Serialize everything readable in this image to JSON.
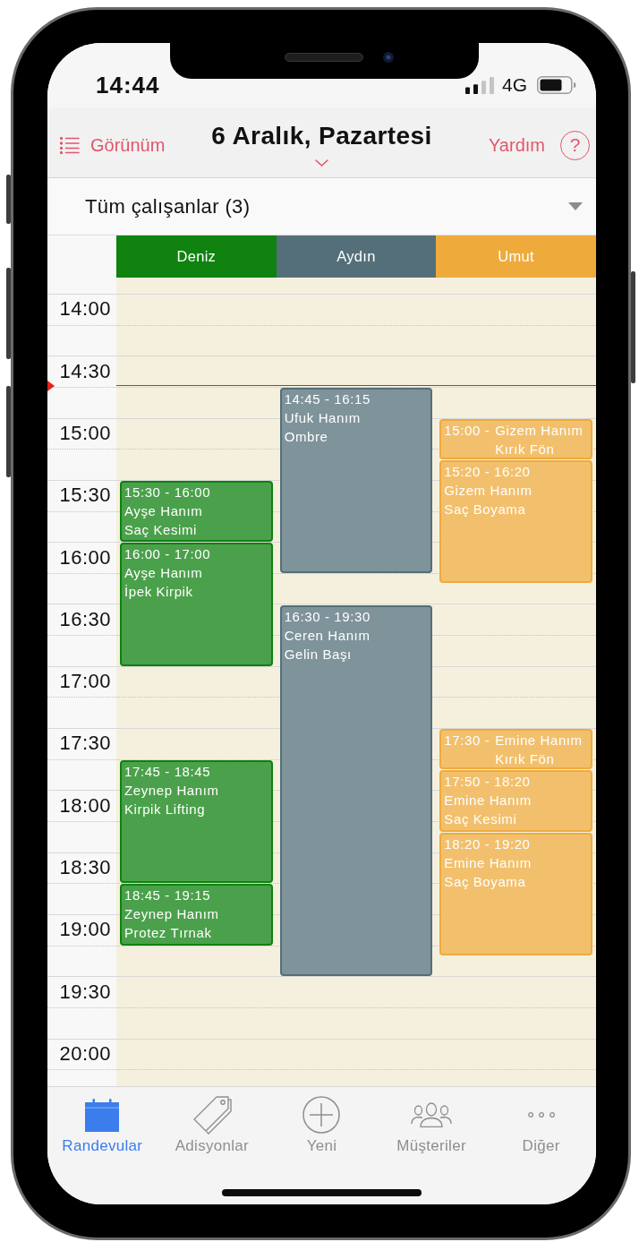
{
  "status_bar": {
    "time": "14:44",
    "network": "4G"
  },
  "header": {
    "view_button": "Görünüm",
    "title": "6 Aralık, Pazartesi",
    "help_link": "Yardım",
    "help_icon": "?"
  },
  "staff_filter": {
    "value": "Tüm çalışanlar (3)"
  },
  "time_slots": [
    "14:00",
    "14:30",
    "15:00",
    "15:30",
    "16:00",
    "16:30",
    "17:00",
    "17:30",
    "18:00",
    "18:30",
    "19:00",
    "19:30",
    "20:00"
  ],
  "staff": [
    {
      "name": "Deniz",
      "color": "#0f820f",
      "appointments": [
        {
          "kind": "full",
          "time": "15:30 - 16:00",
          "client": "Ayşe Hanım",
          "service": "Saç Kesimi"
        },
        {
          "kind": "full",
          "time": "16:00 - 17:00",
          "client": "Ayşe Hanım",
          "service": "İpek Kirpik"
        },
        {
          "kind": "full",
          "time": "17:45 - 18:45",
          "client": "Zeynep Hanım",
          "service": "Kirpik Lifting"
        },
        {
          "kind": "full",
          "time": "18:45 - 19:15",
          "client": "Zeynep Hanım",
          "service": "Protez Tırnak"
        }
      ]
    },
    {
      "name": "Aydın",
      "color": "#546f79",
      "appointments": [
        {
          "kind": "full",
          "time": "14:45 - 16:15",
          "client": "Ufuk Hanım",
          "service": "Ombre"
        },
        {
          "kind": "full",
          "time": "16:30 - 19:30",
          "client": "Ceren Hanım",
          "service": "Gelin Başı"
        }
      ]
    },
    {
      "name": "Umut",
      "color": "#eeab3c",
      "appointments": [
        {
          "kind": "compact",
          "time": "15:00 -",
          "client": "Gizem Hanım",
          "service": "Kırık Fön"
        },
        {
          "kind": "full",
          "time": "15:20 - 16:20",
          "client": "Gizem Hanım",
          "service": "Saç Boyama"
        },
        {
          "kind": "compact",
          "time": "17:30 -",
          "client": "Emine Hanım",
          "service": "Kırık Fön"
        },
        {
          "kind": "full",
          "time": "17:50 - 18:20",
          "client": "Emine Hanım",
          "service": "Saç Kesimi"
        },
        {
          "kind": "full",
          "time": "18:20 - 19:20",
          "client": "Emine Hanım",
          "service": "Saç Boyama"
        }
      ]
    }
  ],
  "tab_bar": [
    {
      "label": "Randevular",
      "selected": true
    },
    {
      "label": "Adisyonlar",
      "selected": false
    },
    {
      "label": "Yeni",
      "selected": false
    },
    {
      "label": "Müşteriler",
      "selected": false
    },
    {
      "label": "Diğer",
      "selected": false
    }
  ]
}
